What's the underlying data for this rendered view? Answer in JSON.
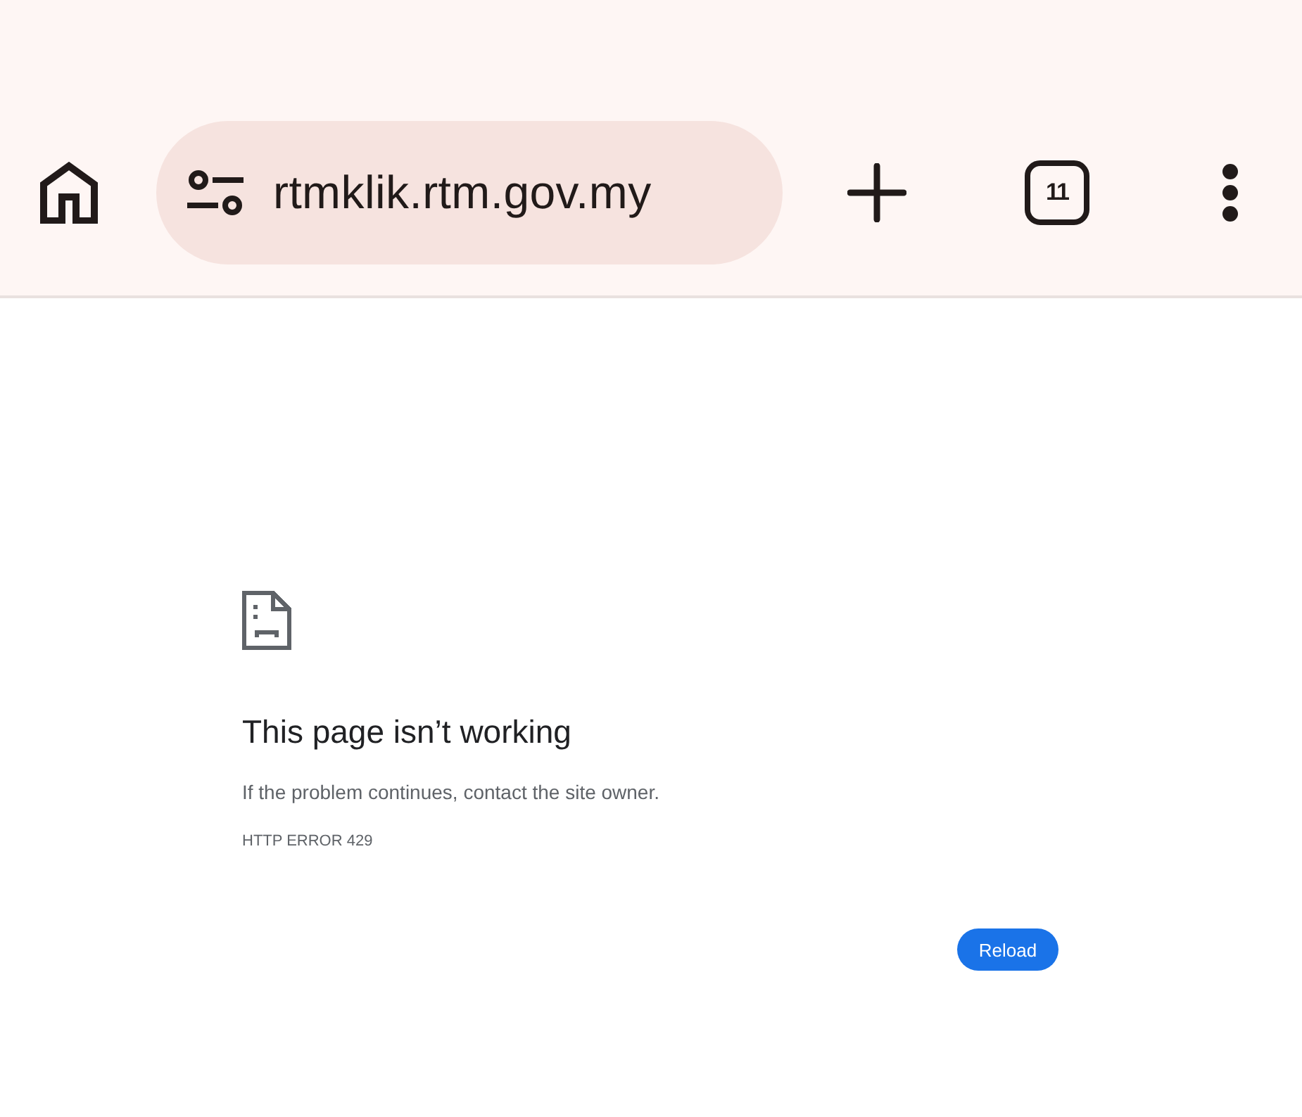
{
  "toolbar": {
    "url": "rtmklik.rtm.gov.my",
    "tab_count": "11"
  },
  "error_page": {
    "title": "This page isn’t working",
    "message": "If the problem continues, contact the site owner.",
    "error_code": "HTTP ERROR 429",
    "button": "Reload"
  }
}
